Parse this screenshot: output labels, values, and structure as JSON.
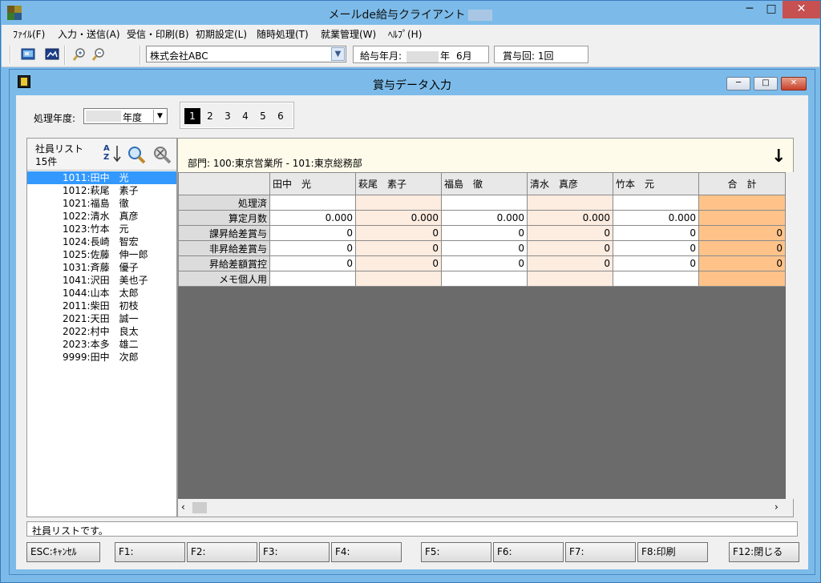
{
  "app": {
    "title": "メールde給与クライアント",
    "window_controls": {
      "minimize": "─",
      "maximize": "□",
      "close": "✕"
    }
  },
  "menu": [
    {
      "label": "ﾌｧｲﾙ(F)"
    },
    {
      "label": "入力・送信(A)"
    },
    {
      "label": "受信・印刷(B)"
    },
    {
      "label": "初期設定(L)"
    },
    {
      "label": "随時処理(T)"
    },
    {
      "label": "就業管理(W)"
    },
    {
      "label": "ﾍﾙﾌﾟ(H)"
    }
  ],
  "toolbar": {
    "company": "株式会社ABC",
    "pay_month_label": "給与年月:",
    "pay_month_year_suffix": "年",
    "pay_month_month": "6月",
    "bonus_count": "賞与回: 1回"
  },
  "form": {
    "title": "賞与データ入力",
    "year_label": "処理年度:",
    "year_suffix": "年度",
    "bonus_numbers": [
      "1",
      "2",
      "3",
      "4",
      "5",
      "6"
    ],
    "active_bonus_number": "1"
  },
  "employee_list": {
    "title": "社員リスト",
    "count": "15件",
    "sort_icon_text": "A Z",
    "items": [
      "1011:田中　光",
      "1012:萩尾　素子",
      "1021:福島　徹",
      "1022:清水　真彦",
      "1023:竹本　元",
      "1024:長崎　智宏",
      "1025:佐藤　伸一郎",
      "1031:斉藤　優子",
      "1041:沢田　美也子",
      "1044:山本　太郎",
      "2011:柴田　初枝",
      "2021:天田　誠一",
      "2022:村中　良太",
      "2023:本多　雄二",
      "9999:田中　次郎"
    ]
  },
  "grid": {
    "department": "部門:  100:東京営業所 - 101:東京総務部",
    "columns": [
      "田中　光",
      "萩尾　素子",
      "福島　徹",
      "清水　真彦",
      "竹本　元",
      "合　計"
    ],
    "rows": [
      {
        "label": "処理済",
        "values": [
          "",
          "",
          "",
          "",
          "",
          ""
        ]
      },
      {
        "label": "算定月数",
        "values": [
          "0.000",
          "0.000",
          "0.000",
          "0.000",
          "0.000",
          ""
        ]
      },
      {
        "label": "課昇給差賞与",
        "values": [
          "0",
          "0",
          "0",
          "0",
          "0",
          "0"
        ]
      },
      {
        "label": "非昇給差賞与",
        "values": [
          "0",
          "0",
          "0",
          "0",
          "0",
          "0"
        ]
      },
      {
        "label": "昇給差額賞控",
        "values": [
          "0",
          "0",
          "0",
          "0",
          "0",
          "0"
        ]
      },
      {
        "label": "メモ個人用",
        "values": [
          "",
          "",
          "",
          "",
          "",
          ""
        ]
      }
    ]
  },
  "status": "社員リストです。",
  "function_keys": [
    "ESC:ｷｬﾝｾﾙ",
    "F1:",
    "F2:",
    "F3:",
    "F4:",
    "F5:",
    "F6:",
    "F7:",
    "F8:印刷",
    "F12:閉じる"
  ],
  "colors": {
    "title_bar": "#7cbbe9",
    "selection": "#3399ff",
    "peach_column": "#fdece0",
    "total_column": "#ffc38a",
    "grid_background": "#6b6b6b"
  }
}
